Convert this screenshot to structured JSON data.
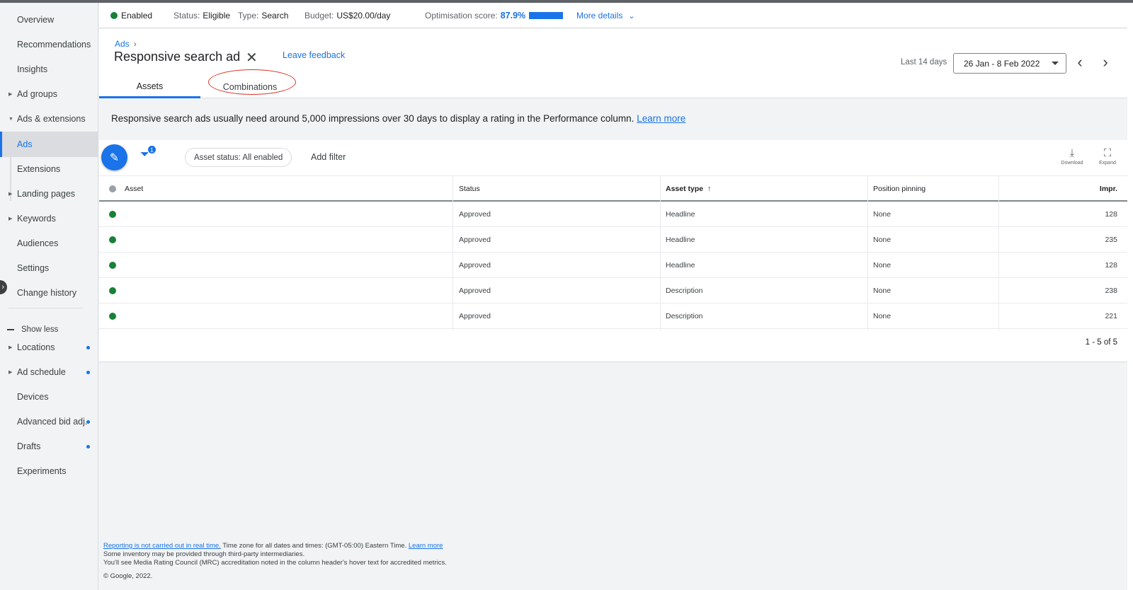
{
  "sidebar": {
    "items": [
      {
        "label": "Overview"
      },
      {
        "label": "Recommendations"
      },
      {
        "label": "Insights"
      },
      {
        "label": "Ad groups"
      },
      {
        "label": "Ads & extensions"
      },
      {
        "label": "Ads"
      },
      {
        "label": "Extensions"
      },
      {
        "label": "Landing pages"
      },
      {
        "label": "Keywords"
      },
      {
        "label": "Audiences"
      },
      {
        "label": "Settings"
      },
      {
        "label": "Change history"
      }
    ],
    "show_less": "Show less",
    "more_items": [
      {
        "label": "Locations"
      },
      {
        "label": "Ad schedule"
      },
      {
        "label": "Devices"
      },
      {
        "label": "Advanced bid adj."
      },
      {
        "label": "Drafts"
      },
      {
        "label": "Experiments"
      }
    ]
  },
  "status_bar": {
    "enabled": "Enabled",
    "status_label": "Status:",
    "status_value": "Eligible",
    "type_label": "Type:",
    "type_value": "Search",
    "budget_label": "Budget:",
    "budget_value": "US$20.00/day",
    "optimisation_label": "Optimisation score:",
    "optimisation_value": "87.9%",
    "more_details": "More details"
  },
  "header": {
    "breadcrumb": "Ads",
    "title": "Responsive search ad",
    "leave_feedback": "Leave feedback",
    "date_label": "Last 14 days",
    "date_range": "26 Jan - 8 Feb 2022",
    "tabs": [
      {
        "label": "Assets"
      },
      {
        "label": "Combinations"
      }
    ]
  },
  "info": {
    "text": "Responsive search ads usually need around 5,000 impressions over 30 days to display a rating in the Performance column.",
    "link": "Learn more"
  },
  "toolbar": {
    "filter_count": "1",
    "chip": "Asset status: All enabled",
    "add_filter": "Add filter",
    "download": "Download",
    "expand": "Expand"
  },
  "table": {
    "headers": {
      "asset": "Asset",
      "status": "Status",
      "asset_type": "Asset type",
      "position_pinning": "Position pinning",
      "impr": "Impr."
    },
    "rows": [
      {
        "status": "Approved",
        "type": "Headline",
        "pinning": "None",
        "impr": "128"
      },
      {
        "status": "Approved",
        "type": "Headline",
        "pinning": "None",
        "impr": "235"
      },
      {
        "status": "Approved",
        "type": "Headline",
        "pinning": "None",
        "impr": "128"
      },
      {
        "status": "Approved",
        "type": "Description",
        "pinning": "None",
        "impr": "238"
      },
      {
        "status": "Approved",
        "type": "Description",
        "pinning": "None",
        "impr": "221"
      }
    ],
    "pagination": "1 - 5 of 5"
  },
  "footer": {
    "not_realtime": "Reporting is not carried out in real time.",
    "timezone": "Time zone for all dates and times: (GMT-05:00) Eastern Time.",
    "learn_more": "Learn more",
    "line2": "Some inventory may be provided through third-party intermediaries.",
    "line3": "You'll see Media Rating Council (MRC) accreditation noted in the column header's hover text for accredited metrics.",
    "copyright": "© Google, 2022."
  },
  "colors": {
    "accent": "#1a73e8",
    "enabled_green": "#188038",
    "annotation_red": "#d93025"
  },
  "optimisation_fraction": 0.879
}
